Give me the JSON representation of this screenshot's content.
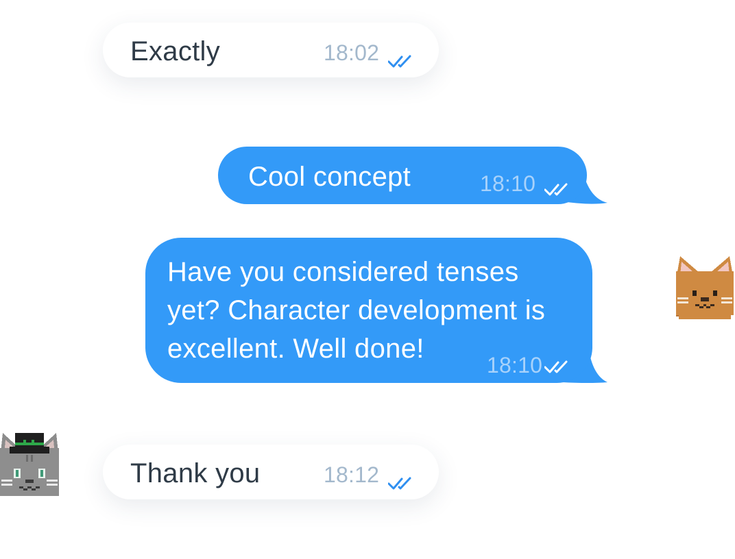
{
  "messages": [
    {
      "text": "Exactly",
      "time": "18:02"
    },
    {
      "text": "Cool concept",
      "time": "18:10"
    },
    {
      "text": "Have you considered tenses\nyet? Character development is\nexcellent. Well done!",
      "time": "18:10"
    },
    {
      "text": "Thank you",
      "time": "18:12"
    }
  ],
  "colors": {
    "outgoing_bubble": "#339af8",
    "incoming_bubble": "#ffffff",
    "incoming_text": "#2f3b47",
    "read_check_incoming": "#2f8ff0",
    "read_check_outgoing": "#ffffff"
  },
  "avatars": {
    "sender": "orange-cat-pixel-avatar",
    "receiver": "gray-cat-with-top-hat-pixel-avatar"
  }
}
